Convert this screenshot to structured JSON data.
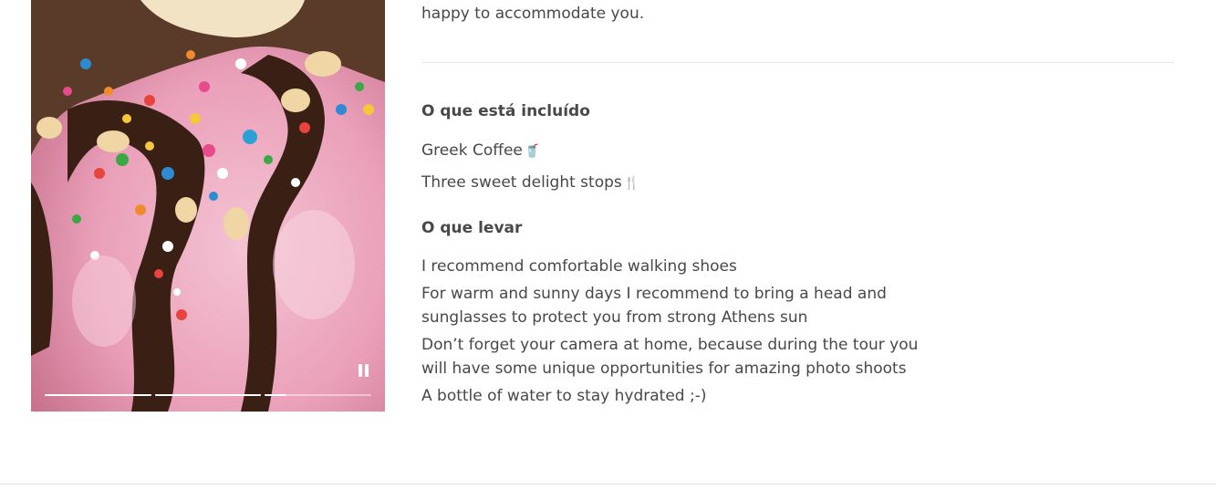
{
  "story": {
    "pause_label": "Pause",
    "progress": [
      1.0,
      1.0,
      0.2
    ]
  },
  "intro_tail": "happy to accommodate you.",
  "included": {
    "title": "O que está incluído",
    "items": [
      {
        "text": "Greek Coffee",
        "icon": "🥤"
      },
      {
        "text": "Three sweet delight stops",
        "icon": "🍴"
      }
    ]
  },
  "bring": {
    "title": "O que levar",
    "items": [
      "I recommend comfortable walking shoes",
      "For warm and sunny days I recommend to bring a head and sunglasses to protect you from strong Athens sun",
      "Don’t forget your camera at home, because during the tour you will have some unique opportunities for amazing photo shoots",
      "A bottle of water to stay hydrated ;-)"
    ]
  }
}
